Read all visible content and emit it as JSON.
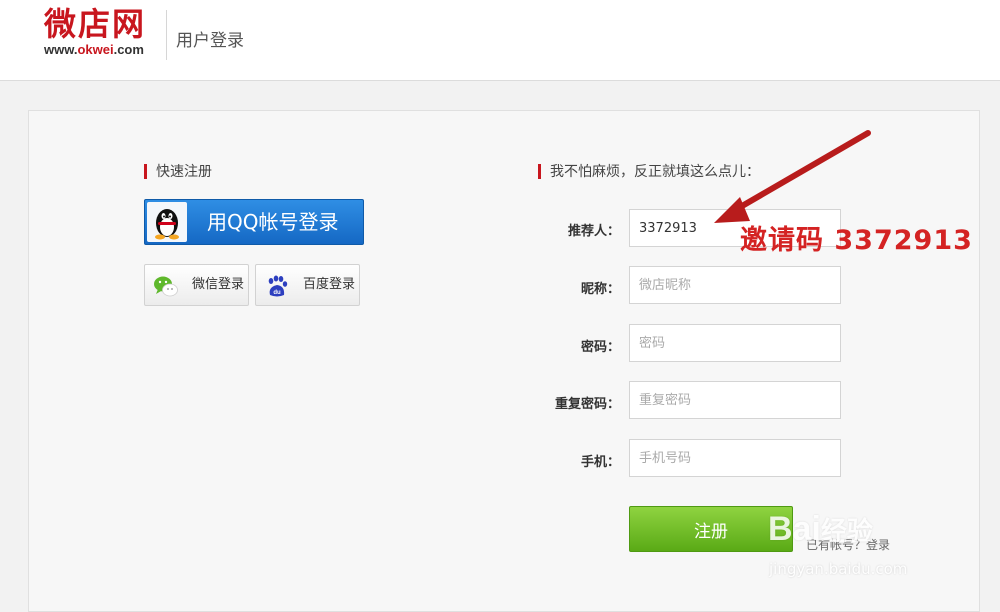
{
  "header": {
    "logo_text": "微店网",
    "logo_url_prefix": "www.",
    "logo_url_brand": "okwei",
    "logo_url_suffix": ".com",
    "page_title": "用户登录"
  },
  "quick_register": {
    "title": "快速注册",
    "qq_button": "用QQ帐号登录",
    "wechat_button": "微信登录",
    "baidu_button": "百度登录"
  },
  "form": {
    "title": "我不怕麻烦，反正就填这么点儿：",
    "fields": [
      {
        "label": "推荐人：",
        "value": "3372913",
        "placeholder": ""
      },
      {
        "label": "昵称：",
        "value": "",
        "placeholder": "微店昵称"
      },
      {
        "label": "密码：",
        "value": "",
        "placeholder": "密码"
      },
      {
        "label": "重复密码：",
        "value": "",
        "placeholder": "重复密码"
      },
      {
        "label": "手机：",
        "value": "",
        "placeholder": "手机号码"
      }
    ],
    "register_button": "注册",
    "below_link": "已有帐号？登录"
  },
  "annotation": {
    "text": "邀请码 3372913"
  },
  "watermark": {
    "logo": "Bai",
    "logo_cn": "经验",
    "url": "jingyan.baidu.com"
  },
  "colors": {
    "brand_red": "#c8161e",
    "qq_blue": "#1e7ad6",
    "register_green": "#6cbf1f",
    "annotation_red": "#d42323"
  },
  "icons": {
    "qq": "qq-penguin-icon",
    "wechat": "wechat-icon",
    "baidu": "baidu-paw-icon",
    "annotation_arrow": "arrow-icon"
  }
}
